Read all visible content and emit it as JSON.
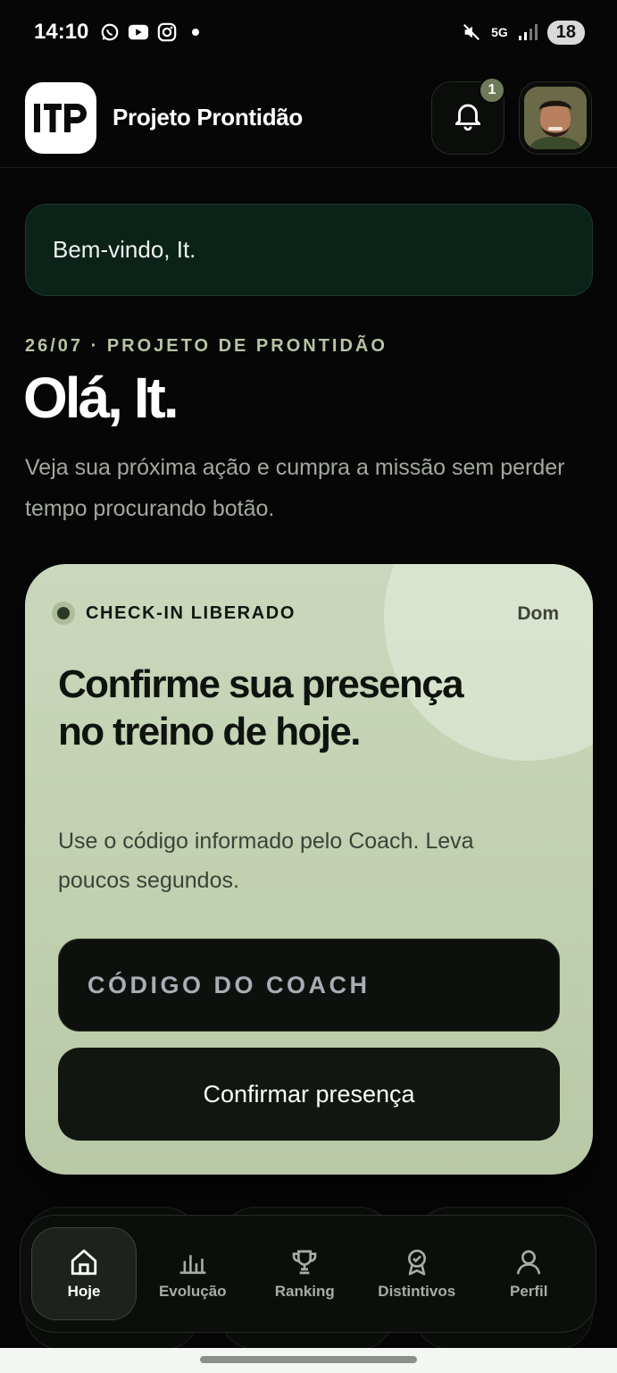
{
  "status_bar": {
    "time": "14:10",
    "network": "5G",
    "battery": "18",
    "icons": [
      "whatsapp-icon",
      "youtube-icon",
      "instagram-icon",
      "dot-icon",
      "mute-icon",
      "signal-icon"
    ]
  },
  "header": {
    "logo_text": "ITP",
    "app_title": "Projeto Prontidão",
    "notification_count": "1"
  },
  "welcome": {
    "text": "Bem-vindo, It."
  },
  "intro": {
    "kicker": "26/07 · PROJETO DE PRONTIDÃO",
    "hello": "Olá, It.",
    "description": "Veja sua próxima ação e cumpra a missão sem perder tempo procurando botão."
  },
  "checkin": {
    "status": "CHECK-IN LIBERADO",
    "day": "Dom",
    "title": "Confirme sua presença no treino de hoje.",
    "description": "Use o código informado pelo Coach. Leva poucos segundos.",
    "code_placeholder": "CÓDIGO DO COACH",
    "confirm_label": "Confirmar presença"
  },
  "nav": {
    "items": [
      {
        "label": "Hoje",
        "icon": "home-icon",
        "active": true
      },
      {
        "label": "Evolução",
        "icon": "chart-icon",
        "active": false
      },
      {
        "label": "Ranking",
        "icon": "trophy-icon",
        "active": false
      },
      {
        "label": "Distintivos",
        "icon": "badge-icon",
        "active": false
      },
      {
        "label": "Perfil",
        "icon": "user-icon",
        "active": false
      }
    ]
  },
  "colors": {
    "accent_card": "#c6d3b6",
    "background": "#050605",
    "welcome_bg": "#0b2219"
  }
}
